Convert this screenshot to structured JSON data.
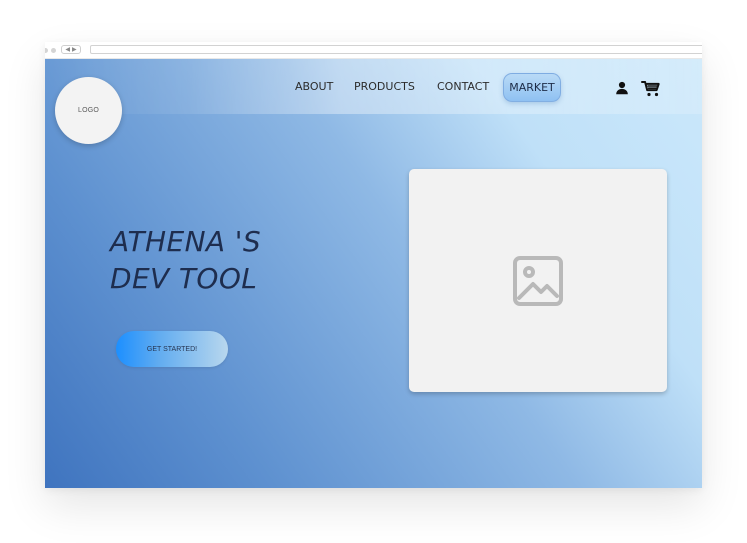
{
  "browser": {
    "nav_back": "◀",
    "nav_forward": "▶",
    "url_value": ""
  },
  "header": {
    "logo": "LOGO",
    "nav_items": [
      {
        "label": "ABOUT"
      },
      {
        "label": "PRODUCTS"
      },
      {
        "label": "CONTACT"
      },
      {
        "label": "MARKET"
      }
    ],
    "icons": [
      {
        "name": "user-icon"
      },
      {
        "name": "shopping-cart-icon"
      }
    ]
  },
  "hero": {
    "title": "ATHENA 'S\nDEV TOOL",
    "cta_label": "GET STARTED!"
  },
  "media": {
    "placeholder_icon": "image-placeholder-icon"
  },
  "colors": {
    "text_dark": "#1e2d4e",
    "logo_bg": "#f3f3f3",
    "card_bg": "#f2f2f2",
    "cta_start": "#1c8fff",
    "cta_end": "#b8d7ee",
    "market_start": "#b9daf6",
    "market_end": "#8fc1f2",
    "background_start": "#3f74bf",
    "background_end": "#cbe8fb"
  }
}
